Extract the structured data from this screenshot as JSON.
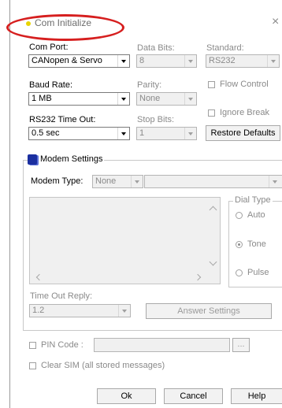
{
  "window": {
    "title": "Com Initialize",
    "close_glyph": "×",
    "accent": "#e8d400",
    "highlight": "#d61f1f"
  },
  "com_port": {
    "label": "Com Port:",
    "value": "CANopen & Servo"
  },
  "data_bits": {
    "label": "Data Bits:",
    "value": "8"
  },
  "standard": {
    "label": "Standard:",
    "value": "RS232"
  },
  "baud_rate": {
    "label": "Baud Rate:",
    "value": "1 MB"
  },
  "parity": {
    "label": "Parity:",
    "value": "None"
  },
  "flow_control": {
    "label": "Flow Control"
  },
  "ignore_break": {
    "label": "Ignore Break"
  },
  "rs232_timeout": {
    "label": "RS232 Time Out:",
    "value": "0.5 sec"
  },
  "stop_bits": {
    "label": "Stop Bits:",
    "value": "1"
  },
  "restore_defaults": {
    "label": "Restore Defaults"
  },
  "modem": {
    "group_title": "Modem Settings",
    "type_label": "Modem Type:",
    "type_value": "None",
    "dial_type": {
      "title": "Dial Type",
      "auto": "Auto",
      "tone": "Tone",
      "pulse": "Pulse"
    },
    "timeout_label": "Time Out Reply:",
    "timeout_value": "1.2",
    "answer_settings": "Answer Settings"
  },
  "pin": {
    "label": "PIN Code :",
    "browse": "..."
  },
  "clear_sim": {
    "label": "Clear SIM (all stored messages)"
  },
  "buttons": {
    "ok": "Ok",
    "cancel": "Cancel",
    "help": "Help"
  }
}
